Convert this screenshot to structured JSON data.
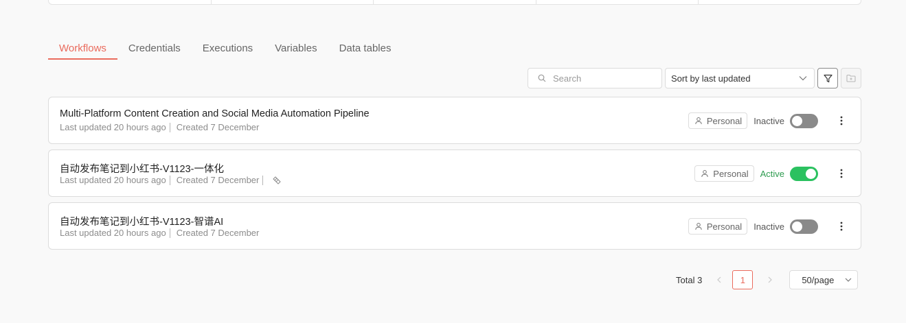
{
  "tabs": [
    {
      "label": "Workflows",
      "active": true
    },
    {
      "label": "Credentials",
      "active": false
    },
    {
      "label": "Executions",
      "active": false
    },
    {
      "label": "Variables",
      "active": false
    },
    {
      "label": "Data tables",
      "active": false
    }
  ],
  "toolbar": {
    "search_placeholder": "Search",
    "sort_value": "Sort by last updated",
    "filter_icon": "filter-icon",
    "folder_icon": "folder-icon"
  },
  "workflows": [
    {
      "title": "Multi-Platform Content Creation and Social Media Automation Pipeline",
      "updated": "Last updated 20 hours ago",
      "created": "Created 7 December",
      "owner": "Personal",
      "status": "Inactive",
      "active": false
    },
    {
      "title": "自动发布笔记到小红书-V1123-一体化",
      "updated": "Last updated 20 hours ago",
      "created": "Created 7 December",
      "owner": "Personal",
      "status": "Active",
      "active": true,
      "extra_icon": "tag-icon"
    },
    {
      "title": "自动发布笔记到小红书-V1123-智谱AI",
      "updated": "Last updated 20 hours ago",
      "created": "Created 7 December",
      "owner": "Personal",
      "status": "Inactive",
      "active": false
    }
  ],
  "pagination": {
    "total": "Total 3",
    "current_page": "1",
    "per_page": "50/page"
  },
  "colors": {
    "accent": "#ea6b5d",
    "active_green": "#2bc160",
    "toggle_off": "#8a8a8a"
  }
}
